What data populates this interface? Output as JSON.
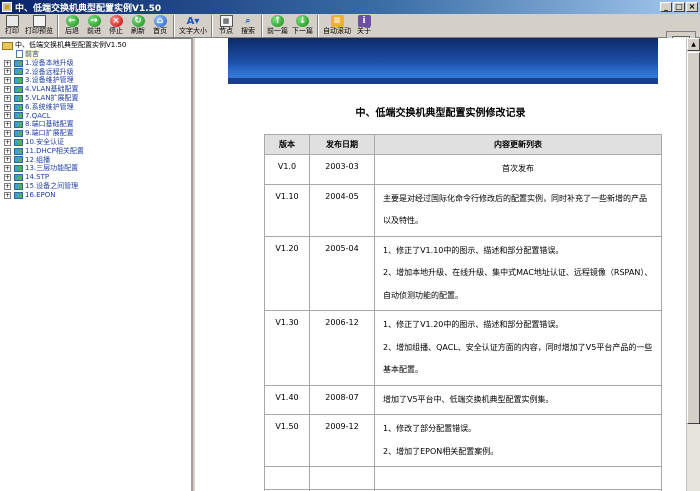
{
  "window": {
    "title": "中、低端交换机典型配置实例V1.50",
    "controls": [
      "_",
      "□",
      "×"
    ]
  },
  "toolbar": [
    {
      "id": "print",
      "label": "打印",
      "icon": "printer-icon",
      "cls": "ico-print",
      "glyph": ""
    },
    {
      "id": "print-preview",
      "label": "打印预览",
      "icon": "print-preview-icon",
      "cls": "ico-preview",
      "glyph": ""
    },
    {
      "sep": true
    },
    {
      "id": "back",
      "label": "后退",
      "icon": "back-arrow-icon",
      "cls": "ico-round green",
      "glyph": "←"
    },
    {
      "id": "forward",
      "label": "前进",
      "icon": "forward-arrow-icon",
      "cls": "ico-round green",
      "glyph": "→"
    },
    {
      "id": "stop",
      "label": "停止",
      "icon": "stop-icon",
      "cls": "ico-round red",
      "glyph": "×"
    },
    {
      "id": "refresh",
      "label": "刷新",
      "icon": "refresh-icon",
      "cls": "ico-round green",
      "glyph": "↻"
    },
    {
      "id": "home",
      "label": "首页",
      "icon": "home-icon",
      "cls": "ico-round blue",
      "glyph": "⌂"
    },
    {
      "sep": true
    },
    {
      "id": "font-size",
      "label": "文字大小",
      "icon": "font-size-icon",
      "cls": "ico-font",
      "glyph": "A▾"
    },
    {
      "sep": true
    },
    {
      "id": "nodes",
      "label": "节点",
      "icon": "nodes-icon",
      "cls": "ico-node",
      "glyph": "▦"
    },
    {
      "id": "search",
      "label": "搜索",
      "icon": "search-icon",
      "cls": "ico-search",
      "glyph": "⌕"
    },
    {
      "sep": true
    },
    {
      "id": "prev-page",
      "label": "前一篇",
      "icon": "previous-page-icon",
      "cls": "ico-round green",
      "glyph": "↑"
    },
    {
      "id": "next-page",
      "label": "下一篇",
      "icon": "next-page-icon",
      "cls": "ico-round green",
      "glyph": "↓"
    },
    {
      "sep": true
    },
    {
      "id": "auto-scroll",
      "label": "自动滚动",
      "icon": "auto-scroll-icon",
      "cls": "ico-auto",
      "glyph": "≡"
    },
    {
      "id": "about",
      "label": "关于",
      "icon": "about-icon",
      "cls": "ico-about",
      "glyph": "i"
    }
  ],
  "tree": {
    "root": "中、低端交换机典型配置实例V1.50",
    "leaf": "前言",
    "items": [
      "1.设备本地升级",
      "2.设备远程升级",
      "3.设备维护管理",
      "4.VLAN基础配置",
      "5.VLAN扩展配置",
      "6.系统维护管理",
      "7.QACL",
      "8.端口基础配置",
      "9.端口扩展配置",
      "10.安全认证",
      "11.DHCP相关配置",
      "12.组播",
      "13.三层功能配置",
      "14.STP",
      "15.设备之间管理",
      "16.EPON"
    ]
  },
  "document": {
    "title": "中、低端交换机典型配置实例修改记录",
    "headers": [
      "版本",
      "发布日期",
      "内容更新列表"
    ],
    "rows": [
      {
        "version": "V1.0",
        "date": "2003-03",
        "lines": [
          "首次发布"
        ],
        "center": true
      },
      {
        "version": "V1.10",
        "date": "2004-05",
        "lines": [
          "主要是对经过国际化命令行修改后的配置实例，同时补充了一些新增的产品以及特性。"
        ]
      },
      {
        "version": "V1.20",
        "date": "2005-04",
        "lines": [
          "1、修正了V1.10中的图示、描述和部分配置错误。",
          "2、增加本地升级、在线升级、集中式MAC地址认证、远程镜像（RSPAN）、自动侦测功能的配置。"
        ]
      },
      {
        "version": "V1.30",
        "date": "2006-12",
        "lines": [
          "1、修正了V1.20中的图示、描述和部分配置错误。",
          "2、增加组播、QACL、安全认证方面的内容，同时增加了V5平台产品的一些基本配置。"
        ]
      },
      {
        "version": "V1.40",
        "date": "2008-07",
        "lines": [
          "增加了V5平台中、低端交换机典型配置实例集。"
        ]
      },
      {
        "version": "V1.50",
        "date": "2009-12",
        "lines": [
          "1、修改了部分配置错误。",
          "2、增加了EPON相关配置案例。"
        ]
      }
    ],
    "empty_rows": 2
  },
  "scrollbar": {
    "up": "▲"
  }
}
